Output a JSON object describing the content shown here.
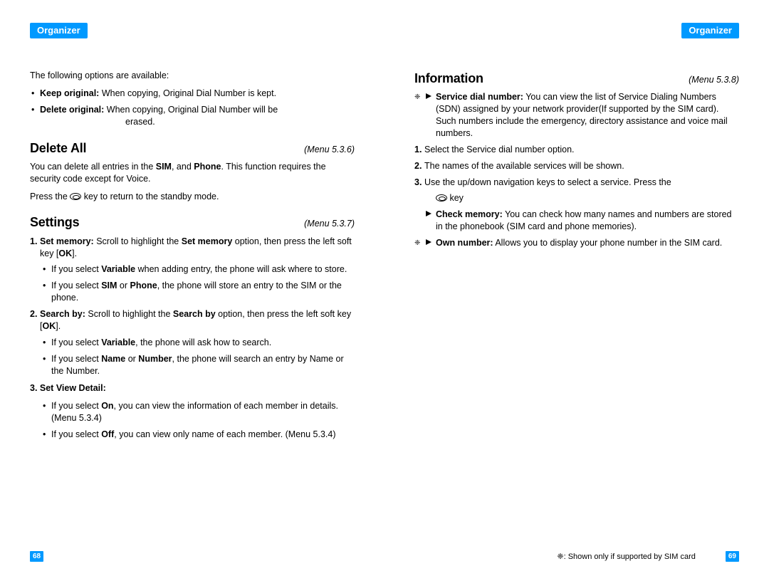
{
  "header": {
    "left": "Organizer",
    "right": "Organizer"
  },
  "left_page": {
    "intro": "The following options are available:",
    "keep_original_label": "Keep original:",
    "keep_original_text": " When copying, Original Dial Number is kept.",
    "delete_original_label": "Delete original:",
    "delete_original_text": " When copying, Original Dial Number will be",
    "erased": "erased.",
    "delete_all": {
      "title": "Delete All",
      "menu": "(Menu 5.3.6)"
    },
    "delete_all_p1a": "You can delete all entries in the ",
    "delete_all_p1b": ", and ",
    "delete_all_p1c": ". This function requires the security code except for Voice.",
    "sim": "SIM",
    "phone": "Phone",
    "press_the": "Press the ",
    "return_standby": " key to return to the standby mode.",
    "settings": {
      "title": "Settings",
      "menu": "(Menu 5.3.7)"
    },
    "set_memory_label": "Set memory:",
    "set_memory_text1": " Scroll to highlight the ",
    "set_memory_bold": "Set memory",
    "set_memory_text2": " option, then press the left soft key [",
    "ok": "OK",
    "close_bracket": "].",
    "var_select": "If you select ",
    "variable": "Variable",
    "sm_var_tail": " when adding entry, the phone will ask where to store.",
    "sm_sim_mid": " or ",
    "sm_sim_tail": ", the phone will store an entry to the SIM or the phone.",
    "search_by_label": "Search by:",
    "search_by_text1": " Scroll to highlight the ",
    "search_by_bold": "Search by",
    "search_by_text2": " option, then press the left soft key [",
    "sb_var_tail": ", the phone will ask how to search.",
    "name": "Name",
    "number": "Number",
    "sb_nn_tail": ", the phone will search an entry by Name or the Number.",
    "svd_label": "3. Set View Detail:",
    "on": "On",
    "svd_on_tail": ", you can view the information of each member in details. (Menu 5.3.4)",
    "off": "Off",
    "svd_off_tail": ", you can view only name of each member. (Menu 5.3.4)",
    "page_num": "68"
  },
  "right_page": {
    "information": {
      "title": "Information",
      "menu": "(Menu 5.3.8)"
    },
    "sdn_label": "Service dial number:",
    "sdn_text": " You can view the list of Service Dialing Numbers (SDN) assigned by your network provider(If supported by the SIM card). Such numbers include the emergency, directory assistance and voice mail numbers.",
    "step1": "Select the Service dial number option.",
    "step2": "The names of the available services will be shown.",
    "step3": "Use the up/down navigation keys to select a service. Press the",
    "key_word": " key",
    "check_memory_label": "Check memory:",
    "check_memory_text": " You can check how many names and numbers are stored in the phonebook (SIM card and phone memories).",
    "own_number_label": "Own number:",
    "own_number_text": " Allows you to display your phone number in the SIM card.",
    "footnote_star": "❈:",
    "footnote": " Shown only if supported by SIM card",
    "page_num": "69"
  }
}
